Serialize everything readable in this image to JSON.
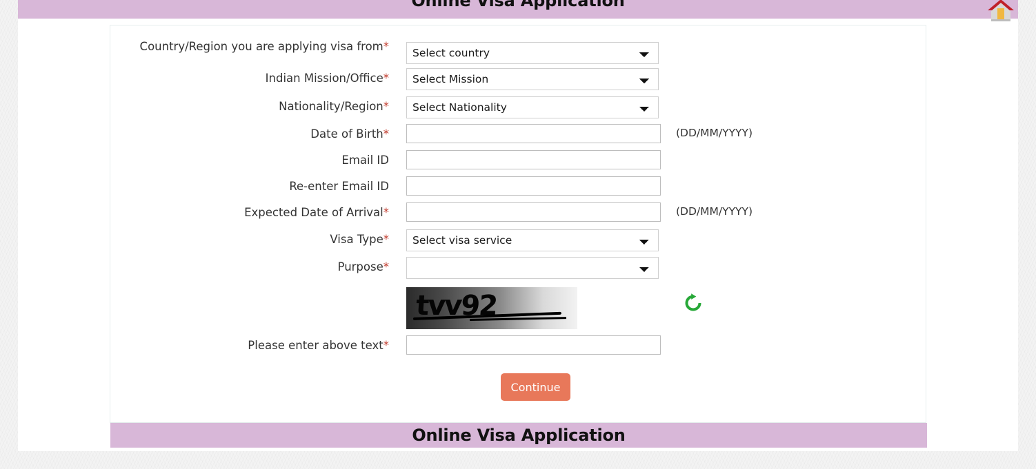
{
  "colors": {
    "banner_purple": "#d8b7d8",
    "required_red": "#c0392b",
    "continue_orange": "#e8785a",
    "refresh_green": "#27a838"
  },
  "header": {
    "title": "Online Visa Application",
    "home_icon": "home-icon"
  },
  "footer": {
    "title": "Online Visa Application"
  },
  "form": {
    "rows": [
      {
        "label": "Country/Region you are applying visa from",
        "required": "*",
        "type": "select",
        "value": "Select country",
        "hint": ""
      },
      {
        "label": "Indian Mission/Office",
        "required": "*",
        "type": "select",
        "value": "Select Mission",
        "hint": ""
      },
      {
        "label": "Nationality/Region",
        "required": "*",
        "type": "select",
        "value": "Select Nationality",
        "hint": ""
      },
      {
        "label": "Date of Birth",
        "required": "*",
        "type": "text",
        "value": "",
        "placeholder": "",
        "hint": "(DD/MM/YYYY)"
      },
      {
        "label": "Email ID",
        "required": "",
        "type": "text",
        "value": "",
        "placeholder": "",
        "hint": ""
      },
      {
        "label": "Re-enter Email ID",
        "required": "",
        "type": "text",
        "value": "",
        "placeholder": "",
        "hint": ""
      },
      {
        "label": "Expected Date of Arrival",
        "required": "*",
        "type": "text",
        "value": "",
        "placeholder": "",
        "hint": "(DD/MM/YYYY)"
      },
      {
        "label": "Visa Type",
        "required": "*",
        "type": "select",
        "value": "Select visa service",
        "hint": ""
      },
      {
        "label": "Purpose",
        "required": "*",
        "type": "select",
        "value": "",
        "hint": ""
      }
    ],
    "captcha": {
      "text": "tvv92",
      "refresh_icon": "refresh-icon",
      "input_label": "Please enter above text",
      "input_required": "*",
      "input_value": "",
      "input_placeholder": ""
    },
    "submit": {
      "label": "Continue"
    }
  }
}
